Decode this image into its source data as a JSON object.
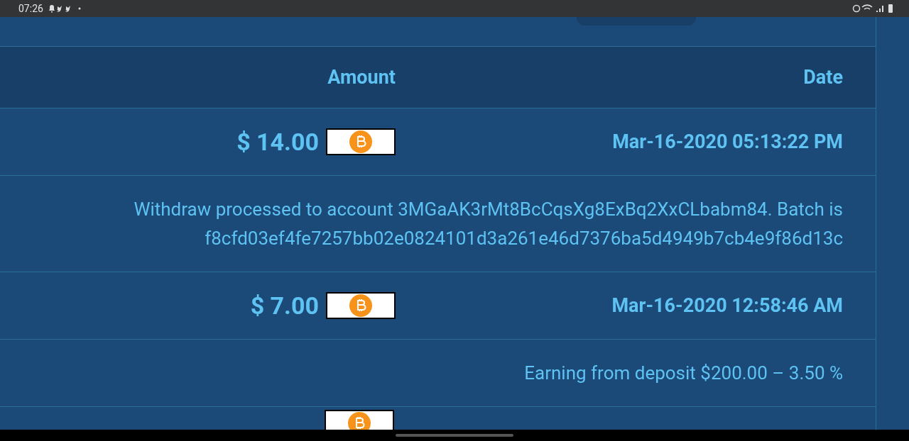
{
  "status_bar": {
    "time": "07:26"
  },
  "table": {
    "columns": [
      "Amount",
      "Date"
    ],
    "rows": [
      {
        "amount": "$ 14.00",
        "date": "Mar-16-2020 05:13:22 PM",
        "description": "Withdraw processed to account 3MGaAK3rMt8BcCqsXg8ExBq2XxCLbabm84. Batch is f8cfd03ef4fe7257bb02e0824101d3a261e46d7376ba5d4949b7cb4e9f86d13c"
      },
      {
        "amount": "$ 7.00",
        "date": "Mar-16-2020 12:58:46 AM",
        "description": "Earning from deposit $200.00 – 3.50 %"
      }
    ]
  }
}
